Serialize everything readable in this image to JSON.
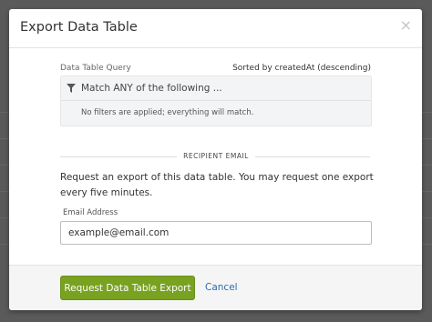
{
  "modal": {
    "title": "Export Data Table",
    "close_icon": "×"
  },
  "query": {
    "label": "Data Table Query",
    "sort_text": "Sorted by createdAt (descending)",
    "filter_icon": "filter-icon",
    "match_text": "Match ANY of the following ...",
    "empty_text": "No filters are applied; everything will match."
  },
  "recipient": {
    "section_title": "RECIPIENT EMAIL",
    "description": "Request an export of this data table. You may request one export every five minutes.",
    "email_label": "Email Address",
    "email_placeholder": "example@email.com",
    "email_value": ""
  },
  "footer": {
    "export_label": "Request Data Table Export",
    "cancel_label": "Cancel"
  },
  "colors": {
    "primary_button": "#78a21f",
    "link": "#2a6db3"
  }
}
